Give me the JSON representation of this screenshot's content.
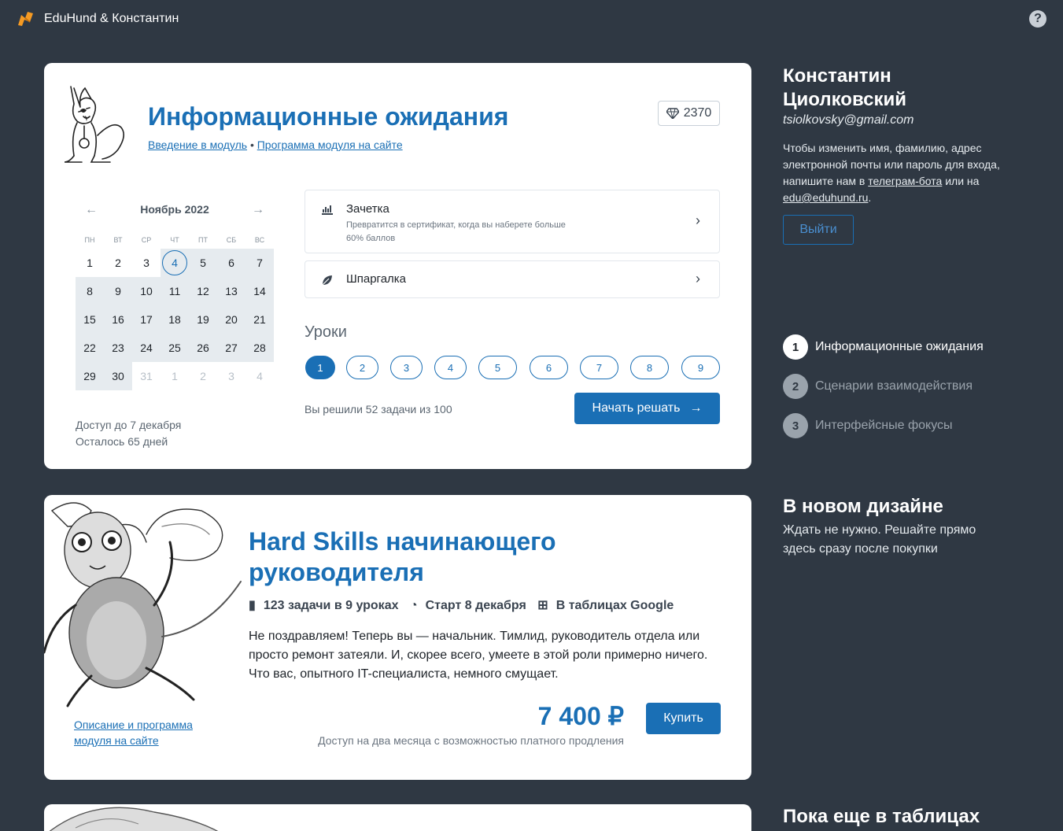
{
  "app": {
    "title": "EduHund & Константин"
  },
  "module": {
    "title": "Информационные ожидания",
    "intro_link": "Введение в модуль",
    "separator": "•",
    "program_link": "Программа модуля на сайте",
    "gems": "2370",
    "calendar": {
      "month": "Ноябрь 2022",
      "weekdays": [
        "ПН",
        "ВТ",
        "СР",
        "ЧТ",
        "ПТ",
        "СБ",
        "ВС"
      ],
      "days": [
        "1",
        "2",
        "3",
        "4",
        "5",
        "6",
        "7",
        "8",
        "9",
        "10",
        "11",
        "12",
        "13",
        "14",
        "15",
        "16",
        "17",
        "18",
        "19",
        "20",
        "21",
        "22",
        "23",
        "24",
        "25",
        "26",
        "27",
        "28",
        "29",
        "30",
        "31",
        "1",
        "2",
        "3",
        "4"
      ],
      "today": "4"
    },
    "access_until": "Доступ до 7 декабря",
    "days_left": "Осталось 65 дней",
    "gradebook": {
      "title": "Зачетка",
      "subtitle": "Превратится в сертификат, когда вы наберете больше 60% баллов"
    },
    "cheatsheet": {
      "title": "Шпаргалка"
    },
    "lessons_heading": "Уроки",
    "lessons": [
      "1",
      "2",
      "3",
      "4",
      "5",
      "6",
      "7",
      "8",
      "9"
    ],
    "active_lesson": "1",
    "solved": "Вы решили 52 задачи из 100",
    "start_button": "Начать решать"
  },
  "course": {
    "title": "Hard Skills начинающего руководителя",
    "tasks": "123 задачи в 9 уроках",
    "start": "Старт 8 декабря",
    "format": "В таблицах Google",
    "description": "Не поздравляем! Теперь вы — начальник. Тимлид, руководитель отдела или просто ремонт затеяли. И, скорее всего, умеете в этой роли примерно ничего. Что вас, опытного IT-специалиста, немного смущает.",
    "link": "Описание и программа модуля на сайте",
    "price": "7 400 ₽",
    "price_note": "Доступ на два месяца с возможностью платного продления",
    "buy_button": "Купить"
  },
  "user": {
    "name": "Константин Циолковский",
    "email": "tsiolkovsky@gmail.com",
    "note_text": "Чтобы изменить имя, фамилию, адрес электронной почты или пароль для входа, напишите нам в",
    "note_link1": "телеграм-бота",
    "note_or": "или на",
    "note_link2": "edu@eduhund.ru",
    "note_end": ".",
    "logout": "Выйти"
  },
  "modules": [
    {
      "n": "1",
      "title": "Информационные ожидания"
    },
    {
      "n": "2",
      "title": "Сценарии взаимодействия"
    },
    {
      "n": "3",
      "title": "Интерфейсные фокусы"
    }
  ],
  "new_design": {
    "heading": "В новом дизайне",
    "text": "Ждать не нужно. Решайте прямо здесь сразу после покупки"
  },
  "tables_heading": "Пока еще в таблицах",
  "colors": {
    "accent": "#1a6fb5",
    "background": "#2f3843",
    "highlight": "#e6ebef",
    "logo": "#f59a23"
  }
}
